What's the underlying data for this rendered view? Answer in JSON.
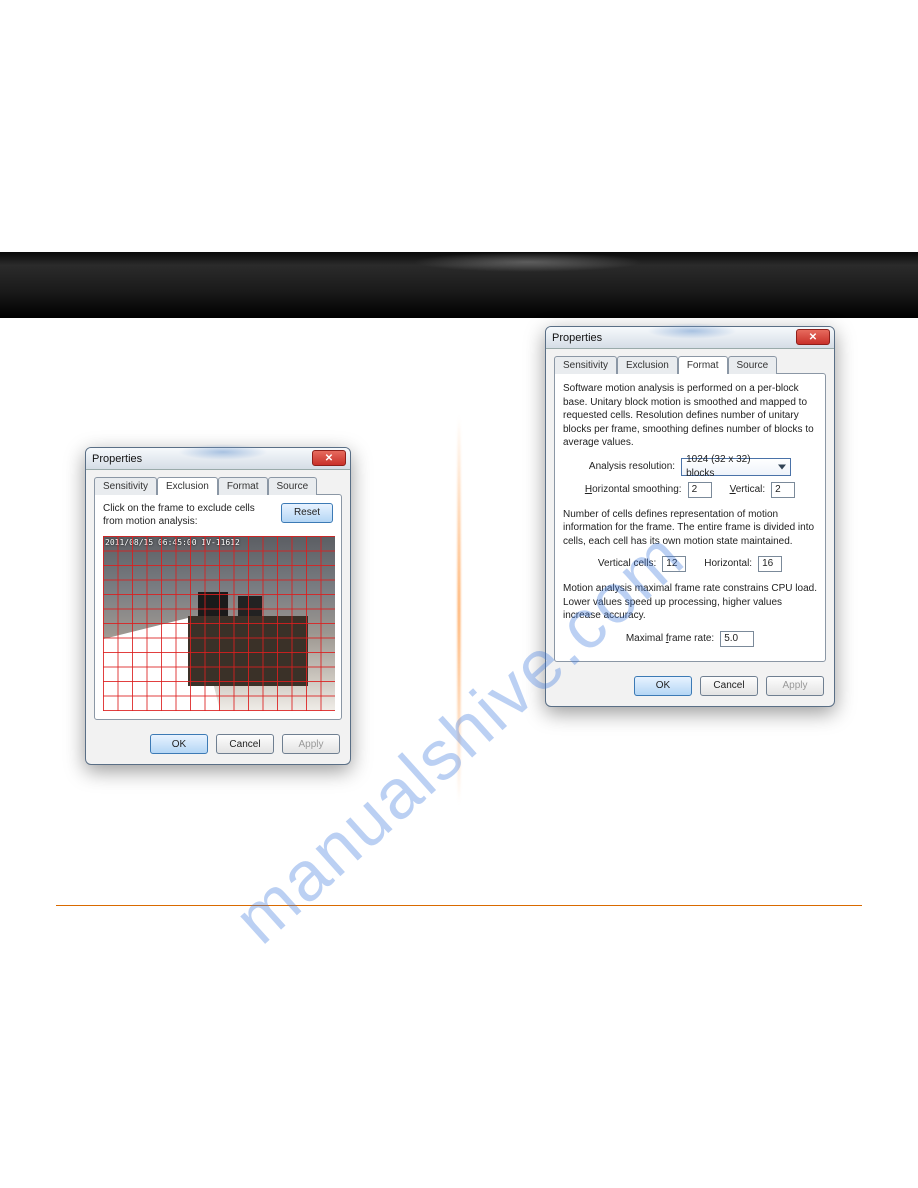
{
  "watermark": "manualshive.com",
  "exclusion_dialog": {
    "title": "Properties",
    "tabs": [
      "Sensitivity",
      "Exclusion",
      "Format",
      "Source"
    ],
    "active_tab": "Exclusion",
    "description": "Click on the frame to exclude cells from motion analysis:",
    "reset_label": "Reset",
    "timestamp_overlay": "2011/08/15 06:45:00 IV-11612",
    "ok_label": "OK",
    "cancel_label": "Cancel",
    "apply_label": "Apply"
  },
  "format_dialog": {
    "title": "Properties",
    "tabs": [
      "Sensitivity",
      "Exclusion",
      "Format",
      "Source"
    ],
    "active_tab": "Format",
    "intro_text": "Software motion analysis is performed on a per-block base. Unitary block motion is smoothed and mapped to requested cells. Resolution defines number of unitary blocks per frame, smoothing defines number of blocks to average values.",
    "analysis_resolution_label": "Analysis resolution:",
    "analysis_resolution_value": "1024 (32 x 32) blocks",
    "horizontal_smoothing_label": "Horizontal smoothing:",
    "horizontal_smoothing_value": "2",
    "vertical_label": "Vertical:",
    "vertical_value": "2",
    "cells_text": "Number of cells defines representation of motion information for the frame. The entire frame is divided into cells, each cell has its own motion state maintained.",
    "vertical_cells_label": "Vertical cells:",
    "vertical_cells_value": "12",
    "horizontal_cells_label": "Horizontal:",
    "horizontal_cells_value": "16",
    "framerate_text": "Motion analysis maximal frame rate constrains CPU load. Lower values speed up processing, higher values increase accuracy.",
    "maximal_framerate_label": "Maximal frame rate:",
    "maximal_framerate_value": "5.0",
    "ok_label": "OK",
    "cancel_label": "Cancel",
    "apply_label": "Apply"
  }
}
